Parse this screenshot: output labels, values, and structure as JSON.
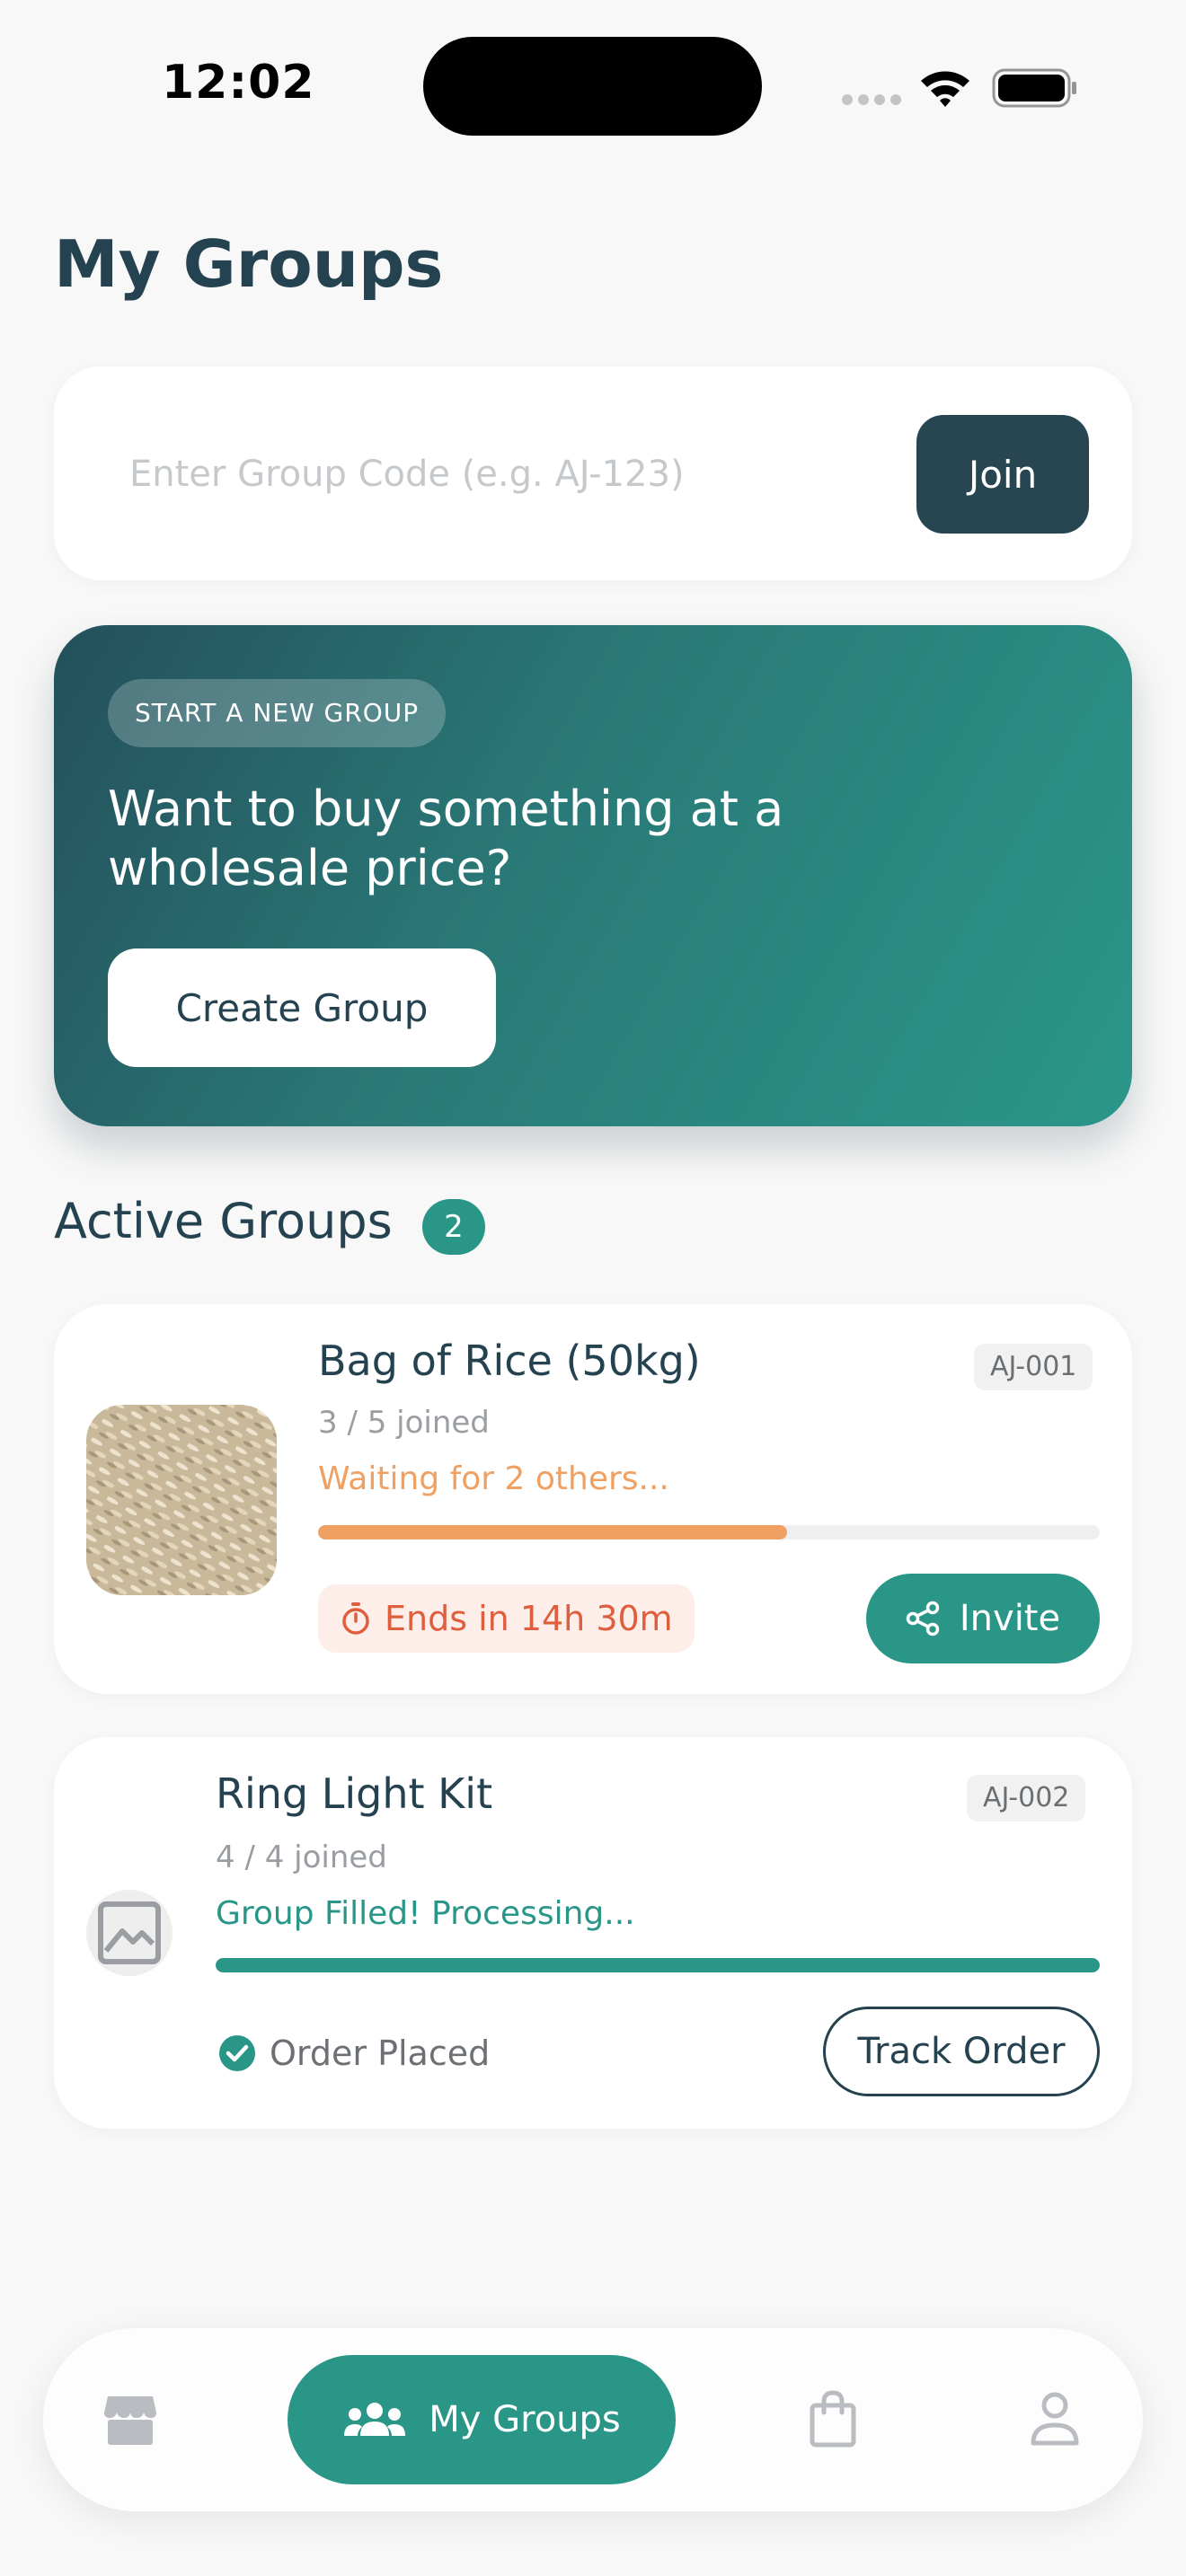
{
  "status_bar": {
    "time": "12:02"
  },
  "header": {
    "title": "My Groups"
  },
  "join": {
    "placeholder": "Enter Group Code (e.g. AJ-123)",
    "value": "",
    "button_label": "Join"
  },
  "create_banner": {
    "badge": "START A NEW GROUP",
    "heading": "Want to buy something at a wholesale price?",
    "button_label": "Create Group"
  },
  "active_groups": {
    "title": "Active Groups",
    "count": "2",
    "items": [
      {
        "title": "Bag of Rice (50kg)",
        "code": "AJ-001",
        "joined": "3 / 5 joined",
        "status": "Waiting for 2 others...",
        "progress": 0.6,
        "timer": "Ends in 14h 30m",
        "action_label": "Invite",
        "icon": "share-icon"
      },
      {
        "title": "Ring Light Kit",
        "code": "AJ-002",
        "joined": "4 / 4 joined",
        "status": "Group Filled! Processing...",
        "progress": 1.0,
        "state_label": "Order Placed",
        "action_label": "Track Order",
        "icon": "image-placeholder-icon"
      }
    ]
  },
  "bottom_nav": {
    "items": [
      {
        "icon": "store-icon"
      },
      {
        "icon": "group-icon",
        "label": "My Groups",
        "active": true
      },
      {
        "icon": "shopping-bag-icon"
      },
      {
        "icon": "profile-icon"
      }
    ]
  },
  "colors": {
    "primary_dark": "#24424f",
    "teal": "#2a9688",
    "orange": "#f0a060",
    "timer_red": "#de5e3e"
  }
}
